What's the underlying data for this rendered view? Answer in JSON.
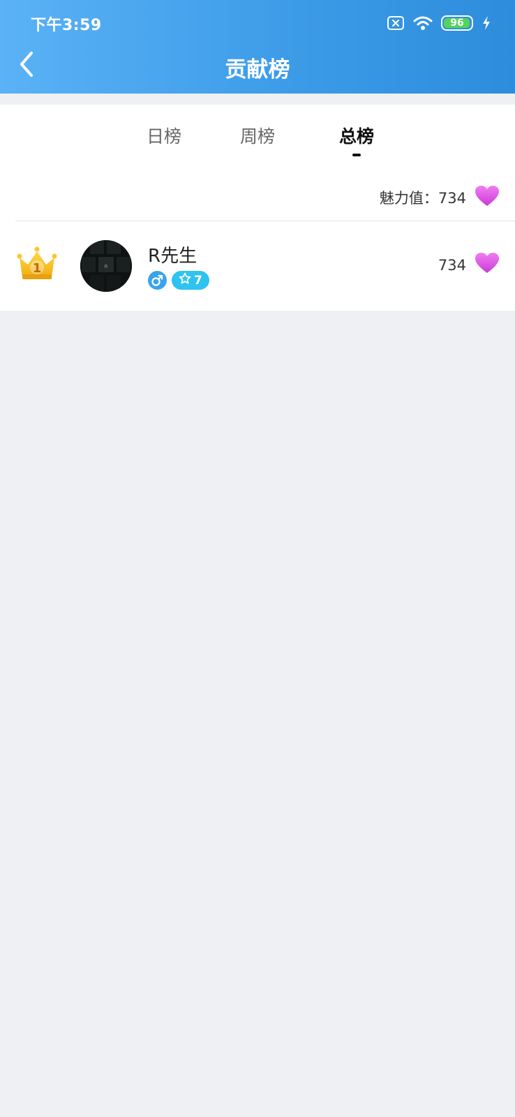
{
  "status_bar": {
    "time": "下午3:59",
    "battery": "96",
    "icons": [
      "sim-error-icon",
      "wifi-icon",
      "battery-icon",
      "charging-icon"
    ]
  },
  "header": {
    "title": "贡献榜",
    "back_icon": "chevron-left-icon"
  },
  "tabs": [
    {
      "label": "日榜",
      "active": false
    },
    {
      "label": "周榜",
      "active": false
    },
    {
      "label": "总榜",
      "active": true
    }
  ],
  "charm": {
    "label": "魅力值：734",
    "icon": "heart-icon"
  },
  "ranking": [
    {
      "rank": "1",
      "rank_icon": "crown-icon",
      "name": "R先生",
      "gender_icon": "male-icon",
      "level": "7",
      "score": "734",
      "score_icon": "heart-icon"
    }
  ],
  "colors": {
    "header_start": "#5bb2f6",
    "header_end": "#2d8ddc",
    "heart": "#d94be0",
    "crown": "#f5c11c",
    "level_badge": "#2fc3f0",
    "gender_badge": "#3aa4ea"
  }
}
